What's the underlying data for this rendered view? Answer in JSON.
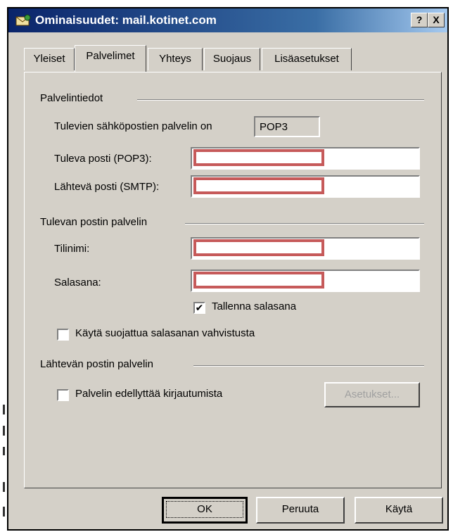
{
  "window": {
    "title": "Ominaisuudet: mail.kotinet.com",
    "help_label": "?",
    "close_label": "X"
  },
  "tabs": [
    {
      "label": "Yleiset"
    },
    {
      "label": "Palvelimet"
    },
    {
      "label": "Yhteys"
    },
    {
      "label": "Suojaus"
    },
    {
      "label": "Lisäasetukset"
    }
  ],
  "server_info": {
    "heading": "Palvelintiedot",
    "incoming_type_label": "Tulevien sähköpostien palvelin on",
    "incoming_type_value": "POP3",
    "incoming_label": "Tuleva posti (POP3):",
    "outgoing_label": "Lähtevä posti (SMTP):"
  },
  "incoming_server": {
    "heading": "Tulevan postin palvelin",
    "account_label": "Tilinimi:",
    "password_label": "Salasana:",
    "save_password_label": "Tallenna salasana",
    "save_password_checked": "✔",
    "spa_label": "Käytä suojattua salasanan vahvistusta"
  },
  "outgoing_server": {
    "heading": "Lähtevän postin palvelin",
    "requires_auth_label": "Palvelin edellyttää kirjautumista",
    "settings_button": "Asetukset..."
  },
  "footer": {
    "ok": "OK",
    "cancel": "Peruuta",
    "apply": "Käytä"
  }
}
